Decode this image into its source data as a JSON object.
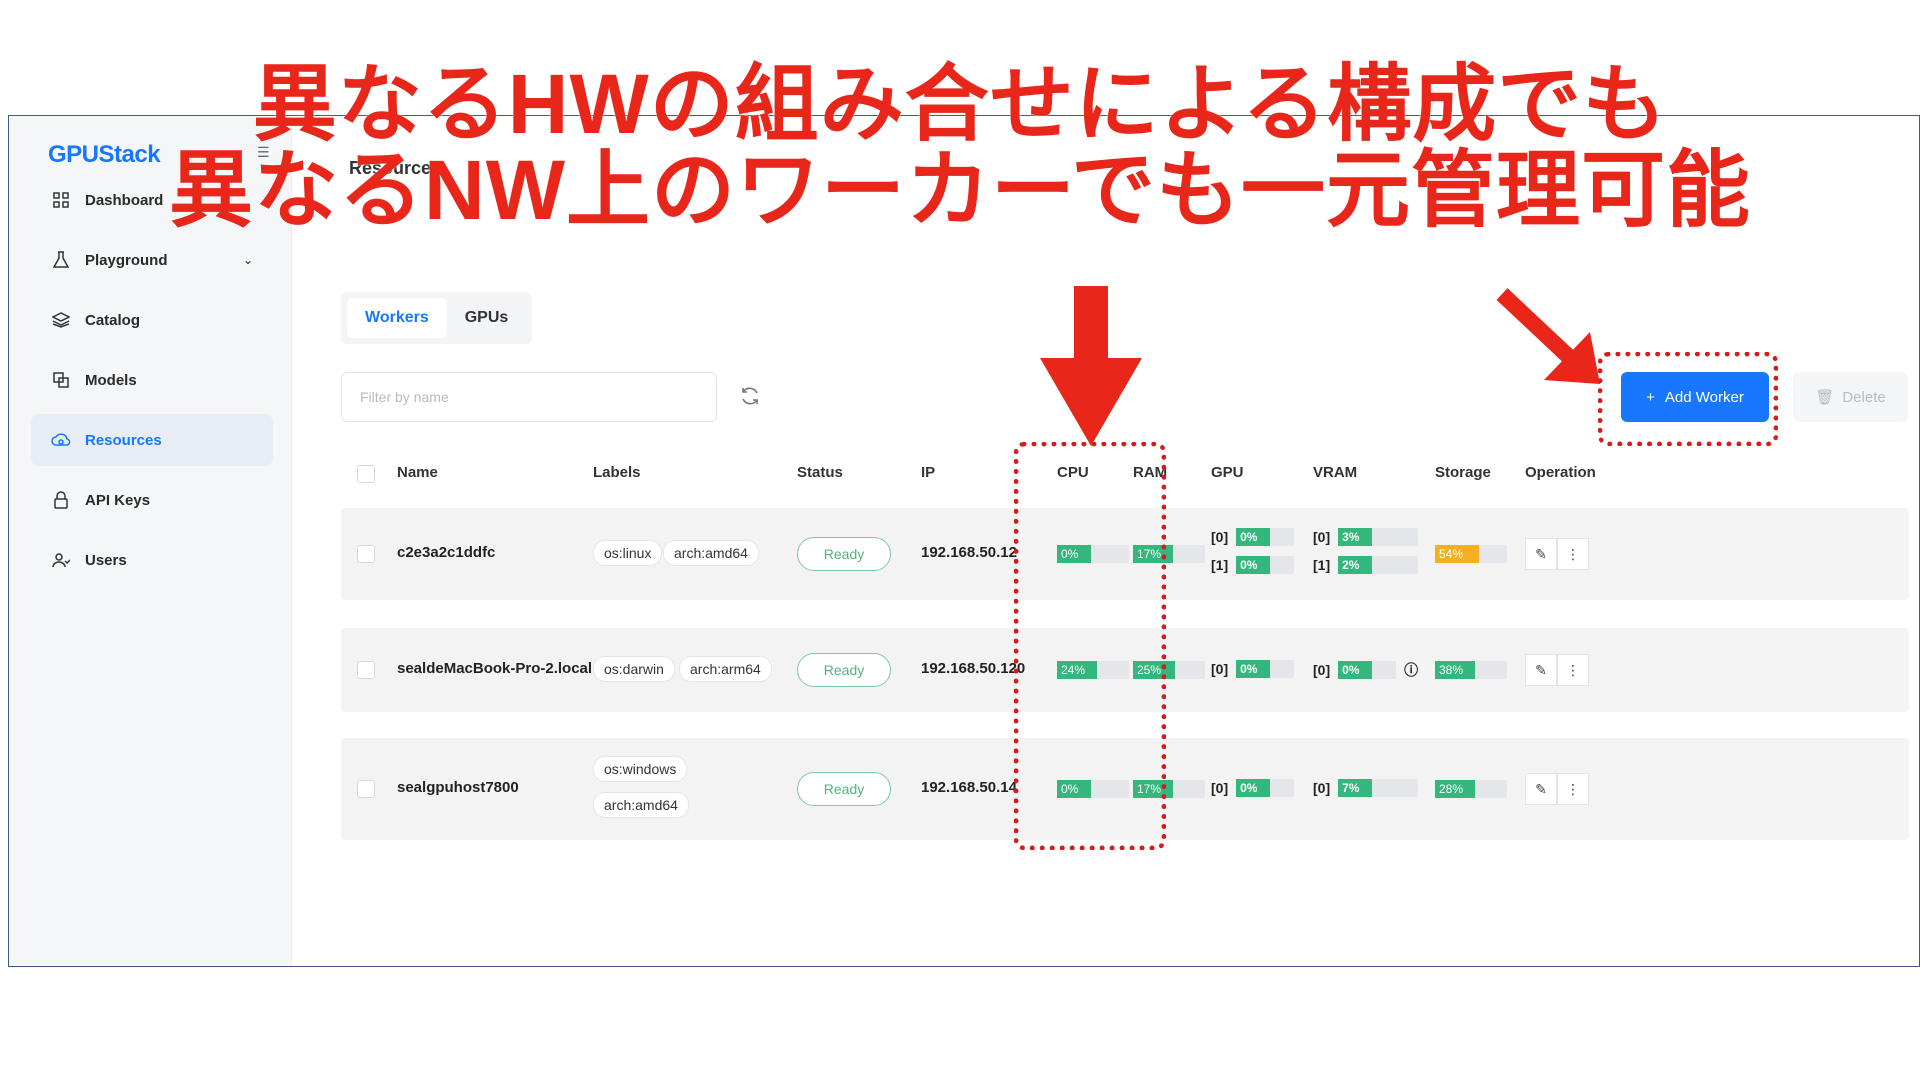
{
  "annotation": {
    "line1": "異なるHWの組み合せによる構成でも",
    "line2": "異なるNW上のワーカーでも一元管理可能"
  },
  "sidebar": {
    "logo": "GPUStack",
    "items": [
      {
        "label": "Dashboard",
        "icon": "grid-icon"
      },
      {
        "label": "Playground",
        "icon": "flask-icon"
      },
      {
        "label": "Catalog",
        "icon": "layers-icon"
      },
      {
        "label": "Models",
        "icon": "box-icon"
      },
      {
        "label": "Resources",
        "icon": "cloud-icon"
      },
      {
        "label": "API Keys",
        "icon": "lock-icon"
      },
      {
        "label": "Users",
        "icon": "users-icon"
      }
    ]
  },
  "header": {
    "breadcrumb": "Resources"
  },
  "tabs": [
    {
      "label": "Workers"
    },
    {
      "label": "GPUs"
    }
  ],
  "toolbar": {
    "filter_placeholder": "Filter by name",
    "add_label": "Add Worker",
    "delete_label": "Delete"
  },
  "table": {
    "columns": [
      "Name",
      "Labels",
      "Status",
      "IP",
      "CPU",
      "RAM",
      "GPU",
      "VRAM",
      "Storage",
      "Operation"
    ],
    "rows": [
      {
        "name": "c2e3a2c1ddfc",
        "labels": [
          "os:linux",
          "arch:amd64"
        ],
        "status": "Ready",
        "ip": "192.168.50.12",
        "cpu": "0%",
        "ram": "17%",
        "gpu": [
          {
            "idx": "[0]",
            "val": "0%"
          },
          {
            "idx": "[1]",
            "val": "0%"
          }
        ],
        "vram": [
          {
            "idx": "[0]",
            "val": "3%"
          },
          {
            "idx": "[1]",
            "val": "2%"
          }
        ],
        "storage": "54%"
      },
      {
        "name": "sealdeMacBook-Pro-2.local",
        "labels": [
          "os:darwin",
          "arch:arm64"
        ],
        "status": "Ready",
        "ip": "192.168.50.120",
        "cpu": "24%",
        "ram": "25%",
        "gpu": [
          {
            "idx": "[0]",
            "val": "0%"
          }
        ],
        "vram": [
          {
            "idx": "[0]",
            "val": "0%"
          }
        ],
        "storage": "38%"
      },
      {
        "name": "sealgpuhost7800",
        "labels": [
          "os:windows",
          "arch:amd64"
        ],
        "status": "Ready",
        "ip": "192.168.50.14",
        "cpu": "0%",
        "ram": "17%",
        "gpu": [
          {
            "idx": "[0]",
            "val": "0%"
          }
        ],
        "vram": [
          {
            "idx": "[0]",
            "val": "7%"
          }
        ],
        "storage": "28%"
      }
    ]
  },
  "colors": {
    "accent": "#1777ff",
    "annotation": "#e8261a",
    "ok": "#33b77d",
    "warn": "#f5b021"
  }
}
